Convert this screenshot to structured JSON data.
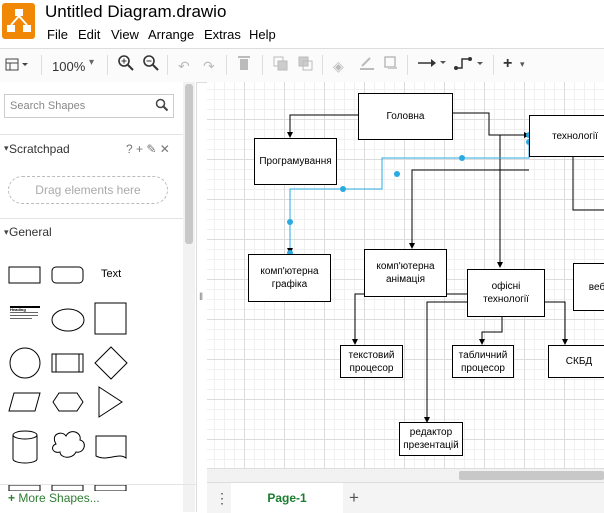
{
  "app": {
    "title": "Untitled Diagram.drawio"
  },
  "menu": [
    "File",
    "Edit",
    "View",
    "Arrange",
    "Extras",
    "Help"
  ],
  "toolbar": {
    "zoom": "100%"
  },
  "sidebar": {
    "search_placeholder": "Search Shapes",
    "scratchpad": "Scratchpad",
    "scratchpad_tools": "? + ✎ ✕",
    "drag_hint": "Drag elements here",
    "general": "General",
    "text_shape": "Text",
    "heading_shape": "Heading",
    "more_shapes": "More Shapes..."
  },
  "diagram": {
    "nodes": {
      "golovna": "Головна",
      "tekhnologii": "технології",
      "programuvannia": "Програмування",
      "kompiuterna_grafika": "комп'ютерна графіка",
      "kompiuterna_animatsiia": "комп'ютерна анімація",
      "ofisni_tekhnologii": "офісні технології",
      "veb": "веб",
      "tekstovyi_protsesor": "текстовий процесор",
      "tablychnyi_protsesor": "табличний процесор",
      "skbd": "СКБД",
      "redaktor_prezentatsii": "редактор презентацій"
    }
  },
  "pages": {
    "current": "Page-1"
  }
}
